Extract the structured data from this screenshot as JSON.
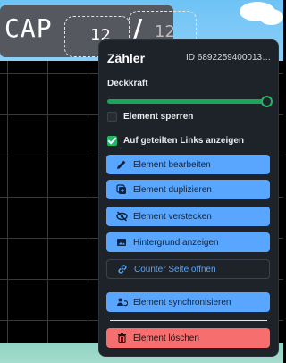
{
  "canvas": {
    "counter_label": "CAP",
    "counter_value": "12",
    "counter_value_secondary": "12",
    "counter_slash": "/"
  },
  "menu": {
    "title": "Zähler",
    "element_id": "ID 689225940001322...",
    "opacity_label": "Deckkraft",
    "opacity_percent": 100,
    "lock_label": "Element sperren",
    "lock_checked": false,
    "share_label": "Auf geteilten Links anzeigen",
    "share_checked": true,
    "buttons": {
      "edit": "Element bearbeiten",
      "duplicate": "Element duplizieren",
      "hide": "Element verstecken",
      "background": "Hintergrund anzeigen",
      "open_counter": "Counter Seite öffnen",
      "sync": "Element synchronisieren",
      "delete": "Element löschen"
    }
  },
  "colors": {
    "menu_bg": "#1d2329",
    "primary": "#58a6ff",
    "success": "#1fb865",
    "danger": "#f76e6e"
  },
  "icons": [
    "pencil-icon",
    "duplicate-icon",
    "eye-off-icon",
    "background-image-icon",
    "link-icon",
    "sync-user-icon",
    "trash-icon"
  ]
}
